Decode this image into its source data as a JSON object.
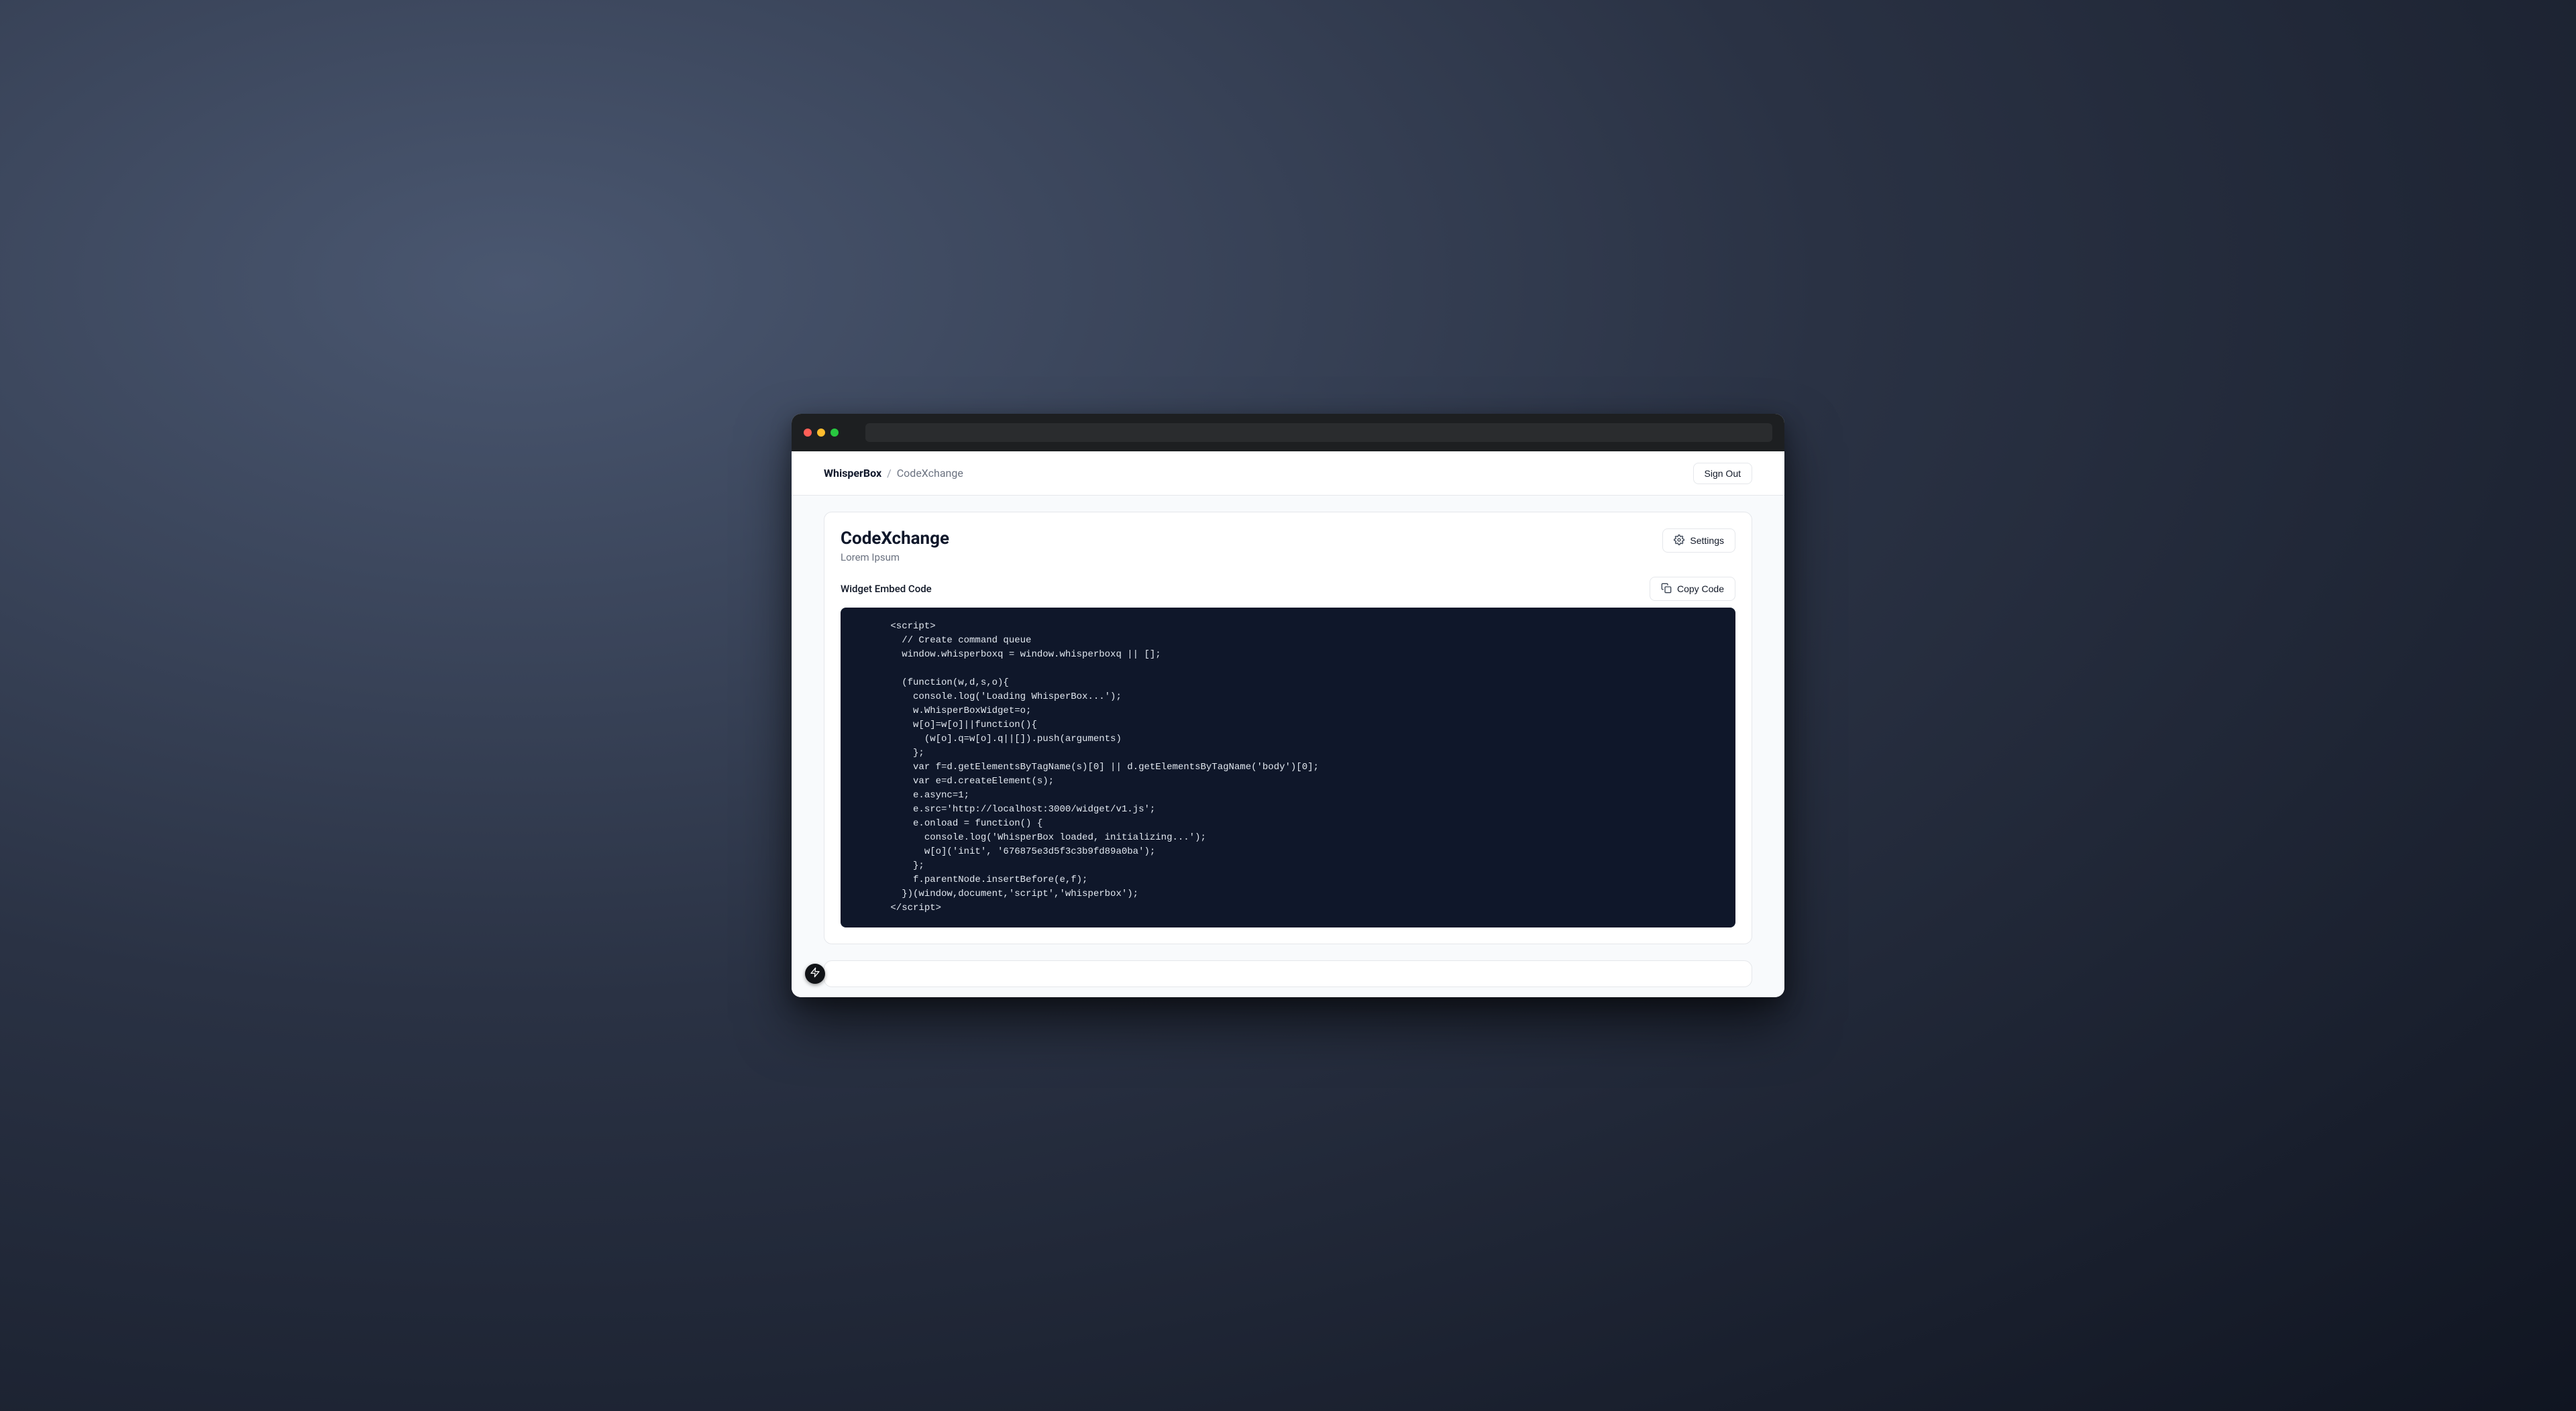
{
  "breadcrumb": {
    "brand": "WhisperBox",
    "separator": "/",
    "current": "CodeXchange"
  },
  "header": {
    "sign_out_label": "Sign Out"
  },
  "project": {
    "title": "CodeXchange",
    "subtitle": "Lorem Ipsum",
    "settings_label": "Settings"
  },
  "embed": {
    "section_label": "Widget Embed Code",
    "copy_label": "Copy Code",
    "code": "      <script>\n        // Create command queue\n        window.whisperboxq = window.whisperboxq || [];\n        \n        (function(w,d,s,o){\n          console.log('Loading WhisperBox...');\n          w.WhisperBoxWidget=o;\n          w[o]=w[o]||function(){\n            (w[o].q=w[o].q||[]).push(arguments)\n          };\n          var f=d.getElementsByTagName(s)[0] || d.getElementsByTagName('body')[0];\n          var e=d.createElement(s);\n          e.async=1;\n          e.src='http://localhost:3000/widget/v1.js';\n          e.onload = function() {\n            console.log('WhisperBox loaded, initializing...');\n            w[o]('init', '676875e3d5f3c3b9fd89a0ba');\n          };\n          f.parentNode.insertBefore(e,f);\n        })(window,document,'script','whisperbox');\n      </script>"
  },
  "icons": {
    "gear": "gear-icon",
    "copy": "copy-icon",
    "bolt": "bolt-icon"
  }
}
